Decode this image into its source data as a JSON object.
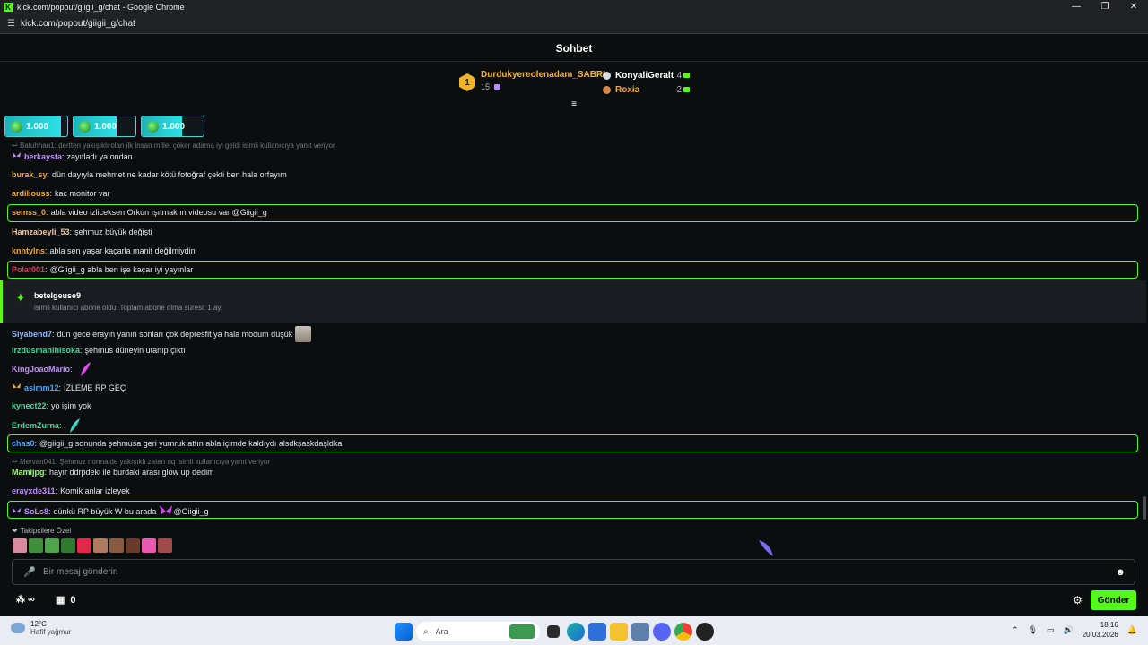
{
  "browser": {
    "window_title": "kick.com/popout/giigii_g/chat - Google Chrome",
    "url": "kick.com/popout/giigii_g/chat"
  },
  "chat": {
    "title": "Sohbet",
    "leaderboard": {
      "first": {
        "rank": "1",
        "name": "Durdukyereolenadam_SABRI",
        "count": "15"
      },
      "others": [
        {
          "name": "KonyaliGeralt",
          "count": "4"
        },
        {
          "name": "Roxia",
          "count": "2"
        }
      ]
    },
    "goals": [
      {
        "label": "1.000",
        "progress": 0.9
      },
      {
        "label": "1.000",
        "progress": 0.7
      },
      {
        "label": "1.000",
        "progress": 0.65
      }
    ],
    "reply1": "Batuhhan1: dertten yakışıklı olan ilk insan millet çöker adama iyi geldi isimli kullanıcıya yanıt veriyor",
    "messages": [
      {
        "user": "berkaysta",
        "color": "#c08cff",
        "text": "zayıfladı ya ondan"
      },
      {
        "user": "burak_sy",
        "color": "#f4a83e",
        "text": "dün dayıyla mehmet ne kadar kötü fotoğraf çekti ben hala orfayım"
      },
      {
        "user": "ardiliouss",
        "color": "#f4a83e",
        "text": "kac monitor var"
      },
      {
        "user": "semss_0",
        "color": "#f4a83e",
        "text": "abla video izliceksen Orkun ışıtmak ın videosu var @Giigii_g"
      },
      {
        "user": "Hamzabeyli_53",
        "color": "#f3c6a3",
        "text": "şehmuz büyük değişti"
      },
      {
        "user": "knntylns",
        "color": "#f4a83e",
        "text": "abla sen yaşar kaçarla manit değilmiydin"
      },
      {
        "user": "Polat001",
        "color": "#e23a5a",
        "text": "@Giigii_g abla ben işe kaçar iyi yayınlar"
      },
      {
        "user": "Siyabend7",
        "color": "#8fb7ff",
        "text": "dün gece erayın yanın sonları çok depresfit ya hala modum düşük"
      },
      {
        "user": "Irzdusmanihisoka",
        "color": "#43d9a0",
        "text": "şehmus düneyin utanıp çıktı"
      },
      {
        "user": "KingJoaoMario",
        "color": "#c08cff",
        "text": ""
      },
      {
        "user": "asimm12",
        "color": "#4da6ff",
        "text": "İZLEME RP GEÇ"
      },
      {
        "user": "kynect22",
        "color": "#43d9a0",
        "text": "yo işim yok"
      },
      {
        "user": "ErdemZurna",
        "color": "#43d9a0",
        "text": ""
      },
      {
        "user": "chas0",
        "color": "#4da6ff",
        "text": "@giigii_g sonunda şehmusa geri yumruk attın abla içimde kaldıydı alsdkşaskdaşldka"
      },
      {
        "user": "Mamijpg",
        "color": "#9bff6b",
        "text": "hayır ddrpdeki ile burdaki arası glow up dedim"
      },
      {
        "user": "erayxde311",
        "color": "#c08cff",
        "text": "Komik anlar izleyek"
      },
      {
        "user": "SoLs8",
        "color": "#c08cff",
        "text": "dünkü RP büyük W bu arada",
        "text2": "@Giigii_g"
      }
    ],
    "reply2": "Mervan041: Şehmuz normalde yakışıklı zaten aq isimli kullanıcıya yanıt veriyor",
    "subscription": {
      "user": "betelgeuse9",
      "text": "isimli kullanıcı abone oldu! Toplam abone olma süresi: 1 ay."
    },
    "followers_only_label": "Takipçilere Özel",
    "input_placeholder": "Bir mesaj gönderin",
    "points_value": "∞",
    "store_count": "0",
    "send_label": "Gönder"
  },
  "taskbar": {
    "temperature": "12°C",
    "weather": "Hafif yağmur",
    "search_placeholder": "Ara",
    "time": "18:16",
    "date": "20.03.2026"
  },
  "colors": {
    "accent": "#53fc18",
    "background": "#0b0e0f"
  }
}
